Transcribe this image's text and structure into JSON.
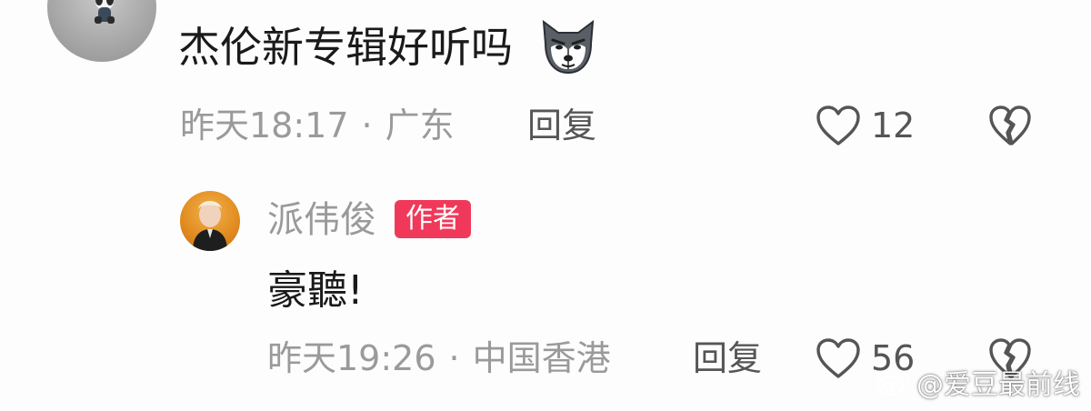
{
  "comment": {
    "text": "杰伦新专辑好听吗",
    "emoji_icon": "wolf-emoji-icon",
    "meta_time": "昨天18:17",
    "separator": "·",
    "meta_location": "广东",
    "reply_label": "回复",
    "like_count": "12"
  },
  "reply": {
    "username": "派伟俊",
    "badge": "作者",
    "text": "豪聽!",
    "meta_time": "昨天19:26",
    "separator": "·",
    "meta_location": "中国香港",
    "reply_label": "回复",
    "like_count": "56"
  },
  "watermark": {
    "text": "@爱豆最前线"
  },
  "colors": {
    "author_badge": "#f0395a",
    "meta_text": "#9a9a9a",
    "main_text": "#1a1a1a"
  }
}
